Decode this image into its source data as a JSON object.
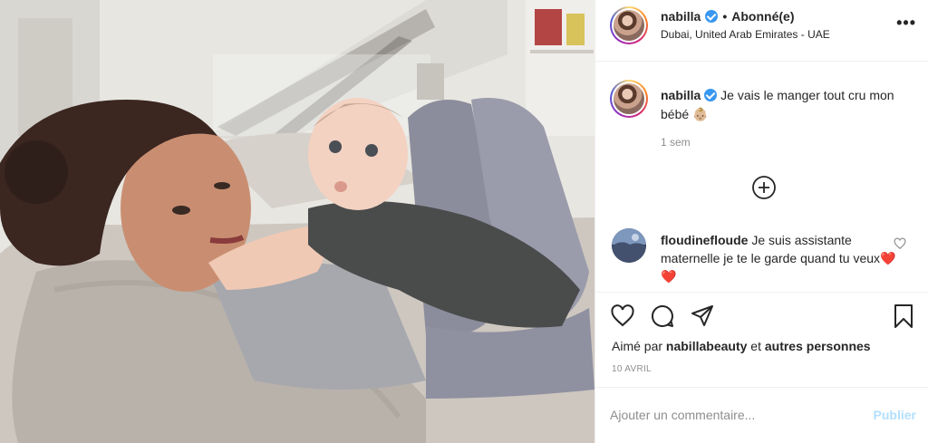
{
  "post": {
    "username": "nabilla",
    "separator": "•",
    "follow_status": "Abonné(e)",
    "location": "Dubai, United Arab Emirates - UAE",
    "more_icon": "more-horizontal-icon",
    "caption_text": "Je vais le manger tout cru mon bébé 👶🏼",
    "time_ago": "1 sem"
  },
  "comment": {
    "username": "floudinefloude",
    "text": "Je suis assistante maternelle je te le garde quand tu veux❤️ ❤️"
  },
  "actions": {
    "icons": [
      "heart-icon",
      "comment-icon",
      "share-icon",
      "bookmark-icon"
    ],
    "liked_prefix": "Aimé par",
    "liked_by": "nabillabeauty",
    "liked_and": "et",
    "liked_others": "autres personnes",
    "date": "10 AVRIL"
  },
  "comment_box": {
    "placeholder": "Ajouter un commentaire...",
    "publish_label": "Publier"
  },
  "colors": {
    "verified": "#3897f0",
    "publish_disabled": "#b2dffc",
    "secondary_text": "#8e8e8e",
    "border": "#efefef"
  }
}
